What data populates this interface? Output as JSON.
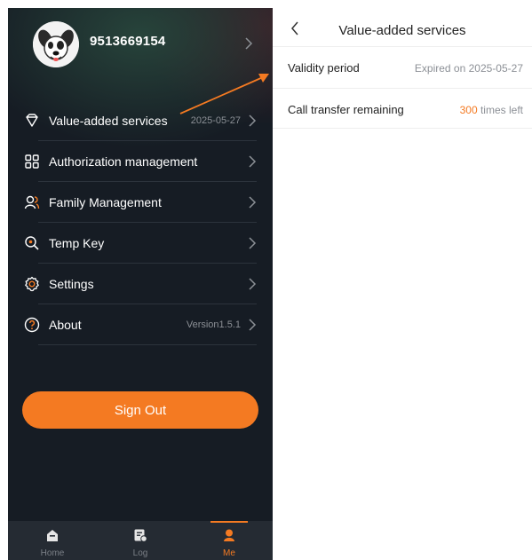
{
  "profile": {
    "username": "9513669154"
  },
  "menu": [
    {
      "label": "Value-added services",
      "value": "2025-05-27",
      "icon": "diamond-icon"
    },
    {
      "label": "Authorization management",
      "value": "",
      "icon": "grid-icon"
    },
    {
      "label": "Family Management",
      "value": "",
      "icon": "people-icon"
    },
    {
      "label": "Temp Key",
      "value": "",
      "icon": "key-search-icon"
    },
    {
      "label": "Settings",
      "value": "",
      "icon": "gear-icon"
    },
    {
      "label": "About",
      "value": "Version1.5.1",
      "icon": "question-icon"
    }
  ],
  "signout_label": "Sign Out",
  "tabs": [
    {
      "label": "Home",
      "icon": "home-icon"
    },
    {
      "label": "Log",
      "icon": "log-icon"
    },
    {
      "label": "Me",
      "icon": "person-icon",
      "active": true
    }
  ],
  "detail": {
    "title": "Value-added services",
    "validity_label": "Validity period",
    "validity_value": "Expired on 2025-05-27",
    "transfer_label": "Call transfer remaining",
    "transfer_count": "300",
    "transfer_suffix": " times left"
  },
  "colors": {
    "accent": "#f47a22",
    "panel_dark": "#161c24",
    "tabbar": "#252b33"
  }
}
